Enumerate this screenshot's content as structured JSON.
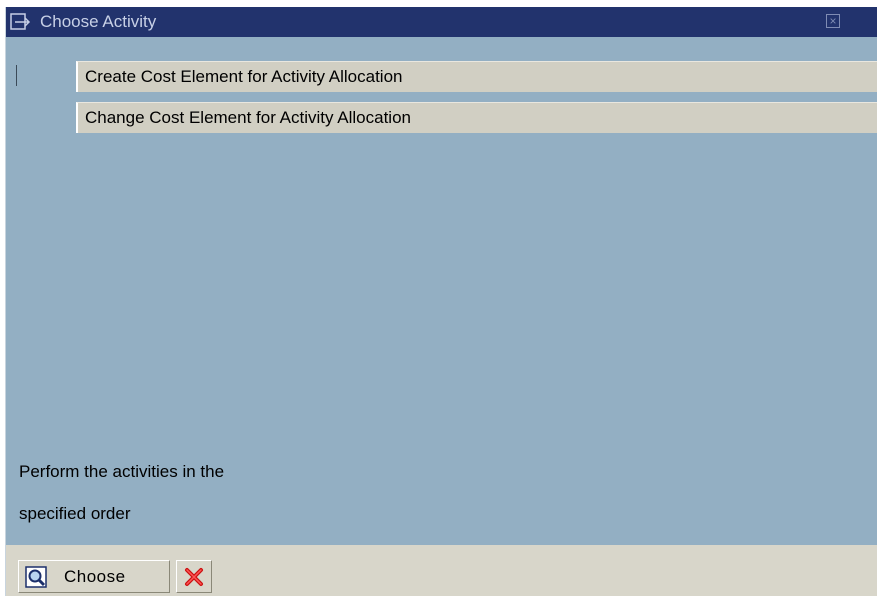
{
  "window": {
    "title": "Choose Activity",
    "title_icon": "dialog-icon",
    "close_icon": "close-icon"
  },
  "activities": [
    {
      "label": "Create Cost Element for Activity Allocation"
    },
    {
      "label": "Change Cost Element for Activity Allocation"
    }
  ],
  "info": {
    "line1": "Perform the activities in the",
    "line2": "specified order"
  },
  "toolbar": {
    "choose_label": "Choose",
    "choose_icon": "magnifier-icon",
    "cancel_icon": "cancel-x-icon"
  },
  "colors": {
    "titlebar": "#22336d",
    "body": "#93afc3",
    "item_background": "#d1cfc3",
    "toolbar": "#d8d6ca",
    "cancel_red": "#cc1111"
  }
}
